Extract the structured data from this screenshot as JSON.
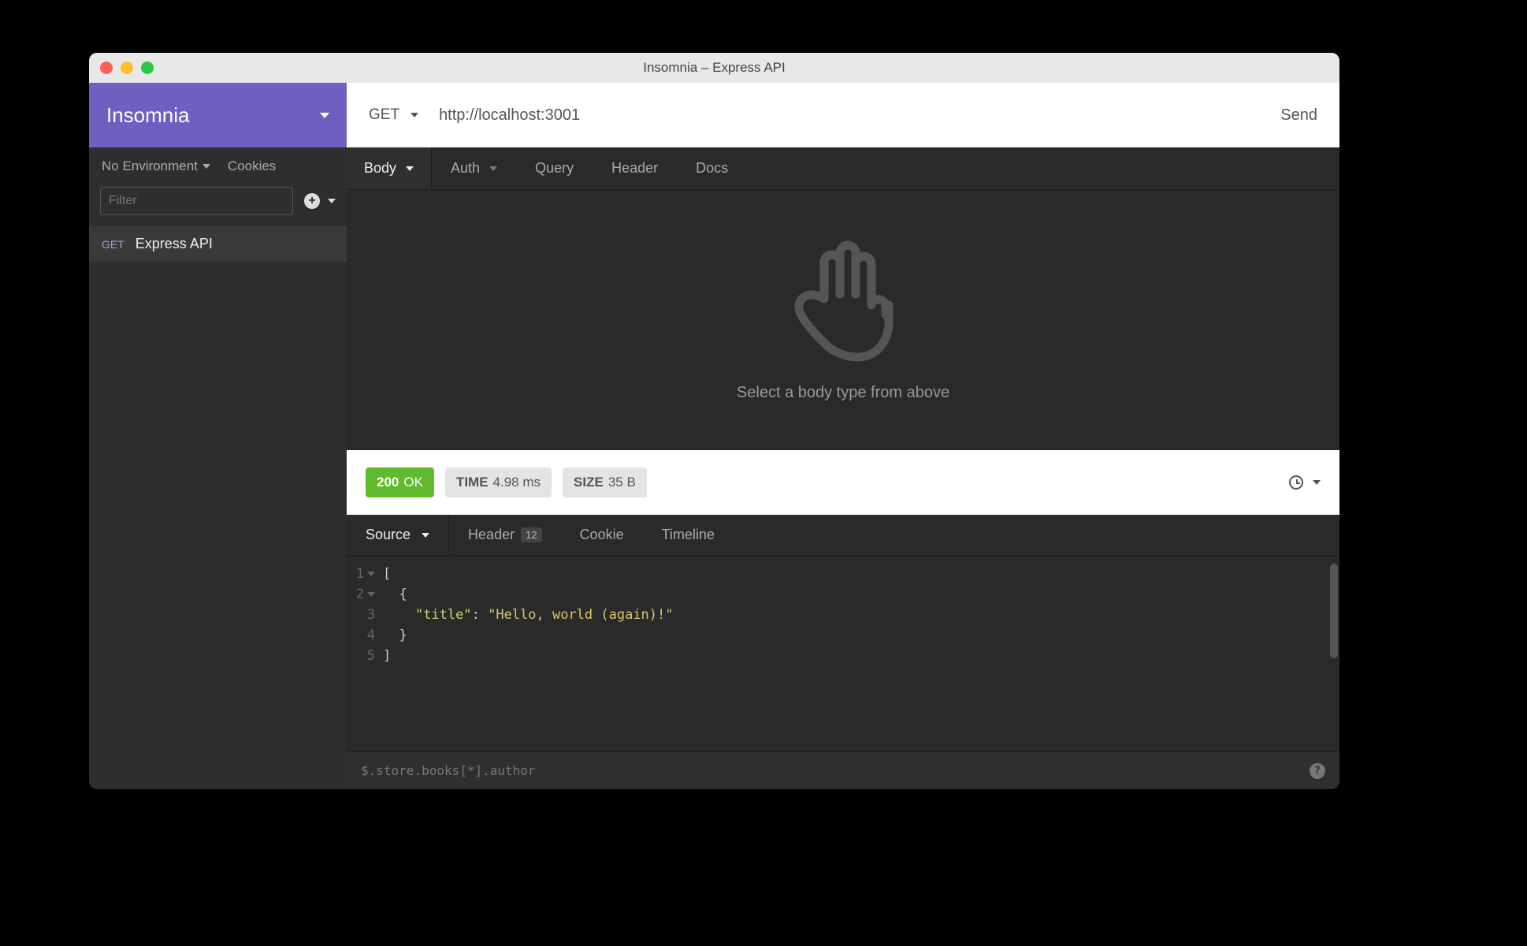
{
  "window": {
    "title": "Insomnia – Express API"
  },
  "sidebar": {
    "app_name": "Insomnia",
    "environment_label": "No Environment",
    "cookies_label": "Cookies",
    "filter_placeholder": "Filter",
    "requests": [
      {
        "method": "GET",
        "name": "Express API"
      }
    ]
  },
  "urlbar": {
    "method": "GET",
    "url": "http://localhost:3001",
    "send_label": "Send"
  },
  "request_tabs": {
    "body": "Body",
    "auth": "Auth",
    "query": "Query",
    "header": "Header",
    "docs": "Docs"
  },
  "body_placeholder": "Select a body type from above",
  "response": {
    "status_code": "200",
    "status_text": "OK",
    "time_label": "TIME",
    "time_value": "4.98 ms",
    "size_label": "SIZE",
    "size_value": "35 B"
  },
  "response_tabs": {
    "source": "Source",
    "header": "Header",
    "header_count": "12",
    "cookie": "Cookie",
    "timeline": "Timeline"
  },
  "code": {
    "lines": [
      {
        "n": "1",
        "foldable": true
      },
      {
        "n": "2",
        "foldable": true
      },
      {
        "n": "3",
        "foldable": false
      },
      {
        "n": "4",
        "foldable": false
      },
      {
        "n": "5",
        "foldable": false
      }
    ],
    "l1": "[",
    "l2": "  {",
    "l3_key": "\"title\"",
    "l3_sep": ": ",
    "l3_val": "\"Hello, world (again)!\"",
    "l4": "  }",
    "l5": "]"
  },
  "jsonpath_placeholder": "$.store.books[*].author"
}
